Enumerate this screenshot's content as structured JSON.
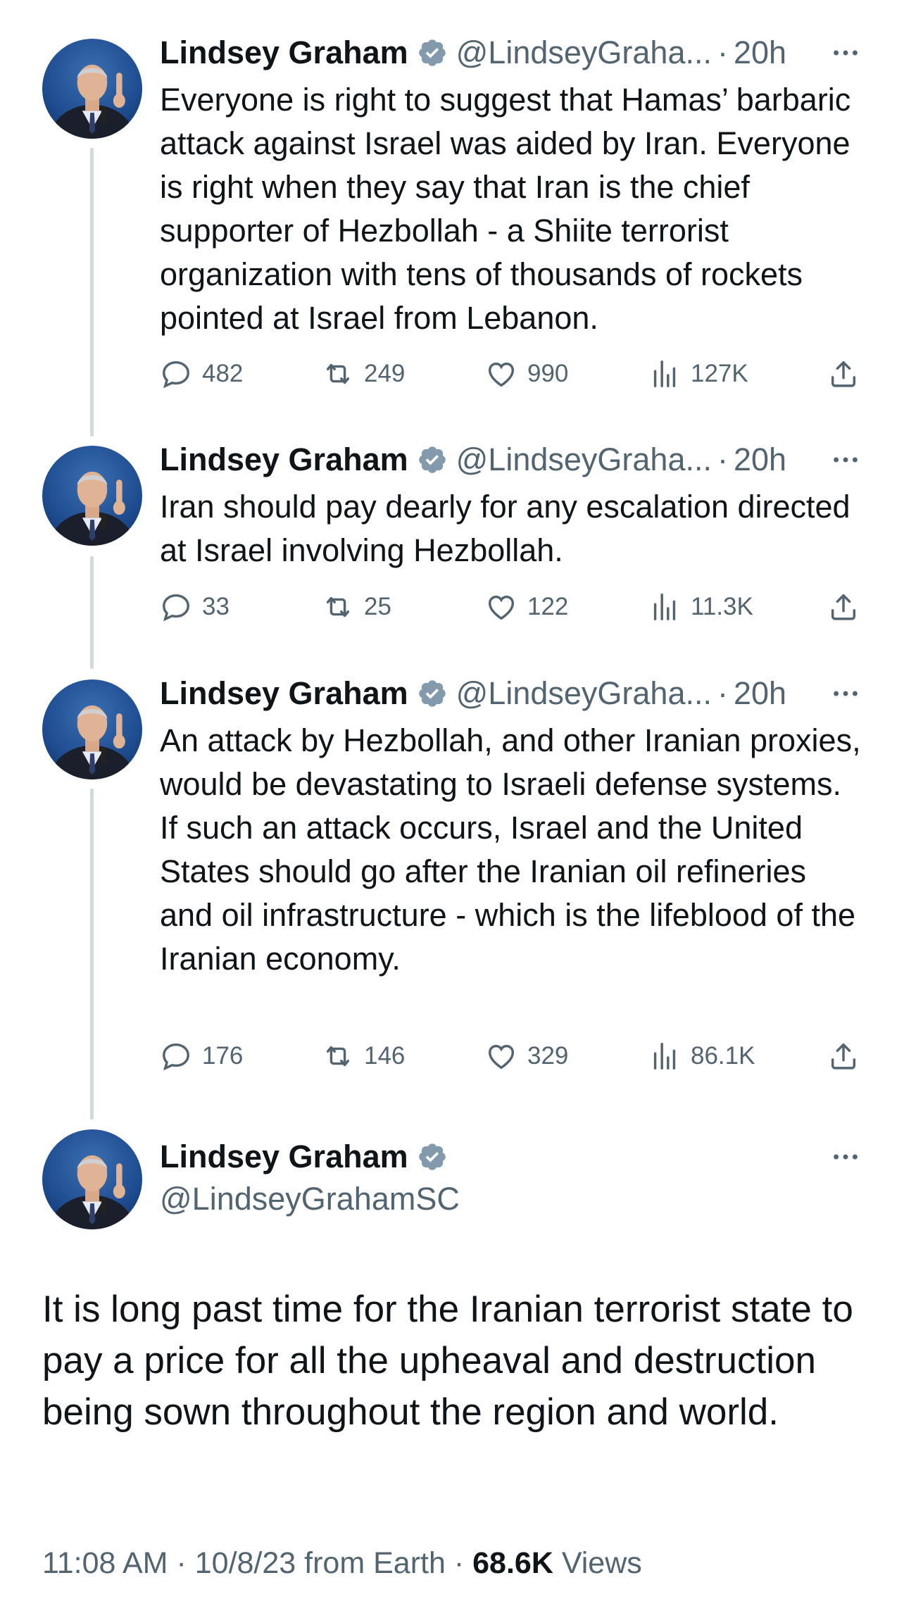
{
  "colors": {
    "text": "#0f1419",
    "secondary": "#536471",
    "thread_line": "#cfd9de",
    "badge": "#829aab"
  },
  "replies": [
    {
      "name": "Lindsey Graham",
      "handle": "@LindseyGraha...",
      "separator": "·",
      "time": "20h",
      "text": "Everyone is right to suggest that Hamas’ barbaric attack against Israel was aided by Iran. Everyone is right when they say that Iran is the chief supporter of Hezbollah - a Shiite terrorist organization with tens of thousands of rockets pointed at Israel from Lebanon.",
      "stats": {
        "replies": "482",
        "reposts": "249",
        "likes": "990",
        "views": "127K"
      }
    },
    {
      "name": "Lindsey Graham",
      "handle": "@LindseyGraha...",
      "separator": "·",
      "time": "20h",
      "text": "Iran should pay dearly for any escalation directed at Israel involving Hezbollah.",
      "stats": {
        "replies": "33",
        "reposts": "25",
        "likes": "122",
        "views": "11.3K"
      }
    },
    {
      "name": "Lindsey Graham",
      "handle": "@LindseyGraha...",
      "separator": "·",
      "time": "20h",
      "text": "An attack by Hezbollah, and other Iranian proxies, would be devastating to Israeli defense systems. If such an attack occurs, Israel and the United States should go after the Iranian oil refineries and oil infrastructure - which is the lifeblood of the Iranian economy.",
      "stats": {
        "replies": "176",
        "reposts": "146",
        "likes": "329",
        "views": "86.1K"
      }
    }
  ],
  "main_tweet": {
    "name": "Lindsey Graham",
    "handle": "@LindseyGrahamSC",
    "text": "It is long past time for the Iranian terrorist state to pay a price for all the upheaval and destruction being sown throughout the region and world.",
    "time": "11:08 AM",
    "date": "10/8/23",
    "source": "from Earth",
    "separator": "·",
    "views_count": "68.6K",
    "views_label": "Views"
  },
  "icons": {
    "verified": "verified-badge-icon",
    "more": "more-options-icon",
    "reply": "reply-icon",
    "repost": "repost-icon",
    "like": "like-icon",
    "views": "views-icon",
    "share": "share-icon"
  }
}
